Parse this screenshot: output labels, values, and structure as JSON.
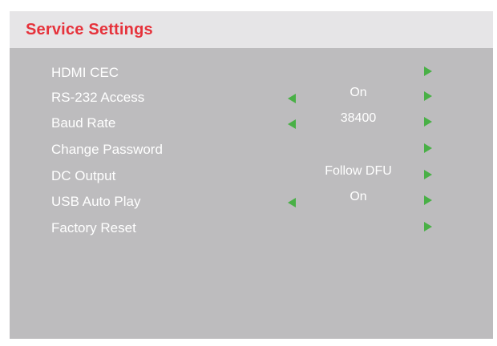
{
  "header": {
    "title": "Service Settings"
  },
  "menu": [
    {
      "label": "HDMI CEC",
      "value": "",
      "left_arrow": false,
      "right_arrow": true
    },
    {
      "label": "RS-232 Access",
      "value": "On",
      "left_arrow": true,
      "right_arrow": true
    },
    {
      "label": "Baud Rate",
      "value": "38400",
      "left_arrow": true,
      "right_arrow": true
    },
    {
      "label": "Change Password",
      "value": "",
      "left_arrow": false,
      "right_arrow": true
    },
    {
      "label": "DC Output",
      "value": "Follow DFU",
      "left_arrow": false,
      "right_arrow": true
    },
    {
      "label": "USB Auto Play",
      "value": "On",
      "left_arrow": true,
      "right_arrow": true
    },
    {
      "label": "Factory Reset",
      "value": "",
      "left_arrow": false,
      "right_arrow": true
    }
  ],
  "colors": {
    "title": "#e6323b",
    "header_bg": "#e6e5e7",
    "panel_bg": "#bdbcbe",
    "arrow": "#49b046",
    "text": "#ffffff"
  },
  "icons": {
    "left_arrow": "left-triangle-icon",
    "right_arrow": "right-triangle-icon"
  }
}
